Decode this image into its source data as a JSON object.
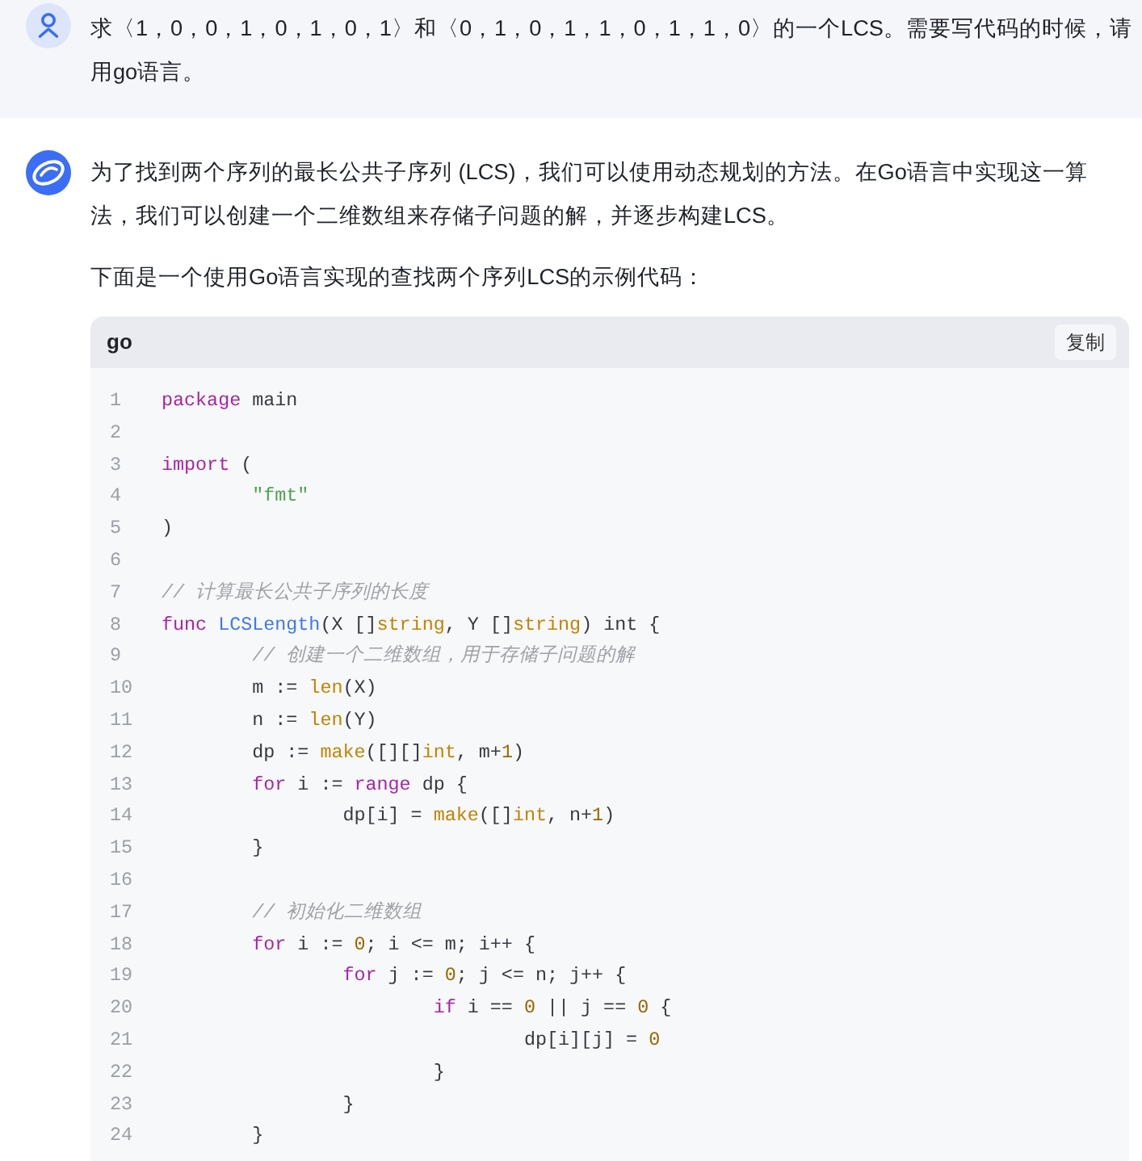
{
  "user_message": {
    "text": "求〈1，0，0，1，0，1，0，1〉和〈0，1，0，1，1，0，1，1，0〉的一个LCS。需要写代码的时候，请用go语言。"
  },
  "assistant_message": {
    "paragraphs": [
      "为了找到两个序列的最长公共子序列 (LCS)，我们可以使用动态规划的方法。在Go语言中实现这一算法，我们可以创建一个二维数组来存储子问题的解，并逐步构建LCS。",
      "下面是一个使用Go语言实现的查找两个序列LCS的示例代码："
    ],
    "code_block": {
      "language": "go",
      "copy_button": "复制",
      "lines": [
        {
          "number": "1",
          "tokens": [
            {
              "text": "package",
              "kind": "keyword"
            },
            {
              "text": " main",
              "kind": "plain"
            }
          ]
        },
        {
          "number": "2"
        },
        {
          "number": "3",
          "tokens": [
            {
              "text": "import",
              "kind": "keyword"
            },
            {
              "text": " (",
              "kind": "plain"
            }
          ]
        },
        {
          "number": "4",
          "tokens": [
            {
              "text": "\t\"fmt\"",
              "kind": "string"
            }
          ]
        },
        {
          "number": "5",
          "tokens": [
            {
              "text": ")",
              "kind": "plain"
            }
          ]
        },
        {
          "number": "6"
        },
        {
          "number": "7",
          "tokens": [
            {
              "text": "// 计算最长公共子序列的长度",
              "kind": "comment"
            }
          ]
        },
        {
          "number": "8",
          "tokens": [
            {
              "text": "func ",
              "kind": "keyword"
            },
            {
              "text": "LCSLength",
              "kind": "function"
            },
            {
              "text": "(X []",
              "kind": "plain"
            },
            {
              "text": "string",
              "kind": "builtin"
            },
            {
              "text": ", Y []",
              "kind": "plain"
            },
            {
              "text": "string",
              "kind": "builtin"
            },
            {
              "text": ") int {",
              "kind": "plain"
            }
          ]
        },
        {
          "number": "9",
          "tokens": [
            {
              "text": "\t// 创建一个二维数组，用于存储子问题的解",
              "kind": "comment"
            }
          ]
        },
        {
          "number": "10",
          "tokens": [
            {
              "text": "\tm := ",
              "kind": "plain"
            },
            {
              "text": "len",
              "kind": "builtin"
            },
            {
              "text": "(X)",
              "kind": "plain"
            }
          ]
        },
        {
          "number": "11",
          "tokens": [
            {
              "text": "\tn := ",
              "kind": "plain"
            },
            {
              "text": "len",
              "kind": "builtin"
            },
            {
              "text": "(Y)",
              "kind": "plain"
            }
          ]
        },
        {
          "number": "12",
          "tokens": [
            {
              "text": "\tdp := ",
              "kind": "plain"
            },
            {
              "text": "make",
              "kind": "builtin"
            },
            {
              "text": "([][]",
              "kind": "plain"
            },
            {
              "text": "int",
              "kind": "builtin"
            },
            {
              "text": ", m+",
              "kind": "plain"
            },
            {
              "text": "1",
              "kind": "number"
            },
            {
              "text": ")",
              "kind": "plain"
            }
          ]
        },
        {
          "number": "13",
          "tokens": [
            {
              "text": "\tfor",
              "kind": "keyword"
            },
            {
              "text": " i := ",
              "kind": "plain"
            },
            {
              "text": "range",
              "kind": "keyword"
            },
            {
              "text": " dp {",
              "kind": "plain"
            }
          ]
        },
        {
          "number": "14",
          "tokens": [
            {
              "text": "\t\tdp[i] = ",
              "kind": "plain"
            },
            {
              "text": "make",
              "kind": "builtin"
            },
            {
              "text": "([]",
              "kind": "plain"
            },
            {
              "text": "int",
              "kind": "builtin"
            },
            {
              "text": ", n+",
              "kind": "plain"
            },
            {
              "text": "1",
              "kind": "number"
            },
            {
              "text": ")",
              "kind": "plain"
            }
          ]
        },
        {
          "number": "15",
          "tokens": [
            {
              "text": "\t}",
              "kind": "plain"
            }
          ]
        },
        {
          "number": "16"
        },
        {
          "number": "17",
          "tokens": [
            {
              "text": "\t// 初始化二维数组",
              "kind": "comment"
            }
          ]
        },
        {
          "number": "18",
          "tokens": [
            {
              "text": "\tfor",
              "kind": "keyword"
            },
            {
              "text": " i := ",
              "kind": "plain"
            },
            {
              "text": "0",
              "kind": "number"
            },
            {
              "text": "; i <= m; i++ {",
              "kind": "plain"
            }
          ]
        },
        {
          "number": "19",
          "tokens": [
            {
              "text": "\t\tfor",
              "kind": "keyword"
            },
            {
              "text": " j := ",
              "kind": "plain"
            },
            {
              "text": "0",
              "kind": "number"
            },
            {
              "text": "; j <= n; j++ {",
              "kind": "plain"
            }
          ]
        },
        {
          "number": "20",
          "tokens": [
            {
              "text": "\t\t\tif",
              "kind": "keyword"
            },
            {
              "text": " i == ",
              "kind": "plain"
            },
            {
              "text": "0",
              "kind": "number"
            },
            {
              "text": " || j == ",
              "kind": "plain"
            },
            {
              "text": "0",
              "kind": "number"
            },
            {
              "text": " {",
              "kind": "plain"
            }
          ]
        },
        {
          "number": "21",
          "tokens": [
            {
              "text": "\t\t\t\tdp[i][j] = ",
              "kind": "plain"
            },
            {
              "text": "0",
              "kind": "number"
            }
          ]
        },
        {
          "number": "22",
          "tokens": [
            {
              "text": "\t\t\t}",
              "kind": "plain"
            }
          ]
        },
        {
          "number": "23",
          "tokens": [
            {
              "text": "\t\t}",
              "kind": "plain"
            }
          ]
        },
        {
          "number": "24",
          "tokens": [
            {
              "text": "\t}",
              "kind": "plain"
            }
          ]
        }
      ]
    }
  }
}
